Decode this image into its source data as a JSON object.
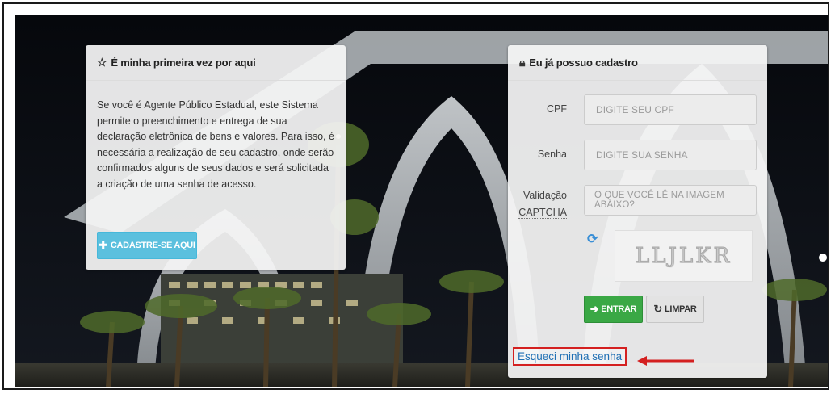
{
  "left_panel": {
    "title": "É minha primeira vez por aqui",
    "title_icon": "star-outline-icon",
    "description": "Se você é Agente Público Estadual, este Sistema permite o preenchimento e entrega de sua declaração eletrônica de bens e valores. Para isso, é necessária a realização de seu cadastro, onde serão confirmados alguns de seus dados e será solicitada a criação de uma senha de acesso.",
    "button_label": "CADASTRE-SE AQUI",
    "button_icon": "plus-icon"
  },
  "right_panel": {
    "title": "Eu já possuo cadastro",
    "title_icon": "lock-icon",
    "cpf_label": "CPF",
    "cpf_placeholder": "DIGITE SEU CPF",
    "senha_label": "Senha",
    "senha_placeholder": "DIGITE SUA SENHA",
    "captcha_label_line1": "Validação",
    "captcha_label_line2": "CAPTCHA",
    "captcha_placeholder": "O QUE VOCÊ LÊ NA IMAGEM ABAIXO?",
    "captcha_text": "LLJLKR",
    "refresh_icon": "refresh-icon",
    "entrar_label": "ENTRAR",
    "limpar_label": "LIMPAR",
    "forgot_link": "Esqueci minha senha"
  },
  "colors": {
    "info_button": "#5bc0de",
    "success_button": "#3aa845",
    "highlight_border": "#d42020",
    "link": "#1f6fb4"
  }
}
